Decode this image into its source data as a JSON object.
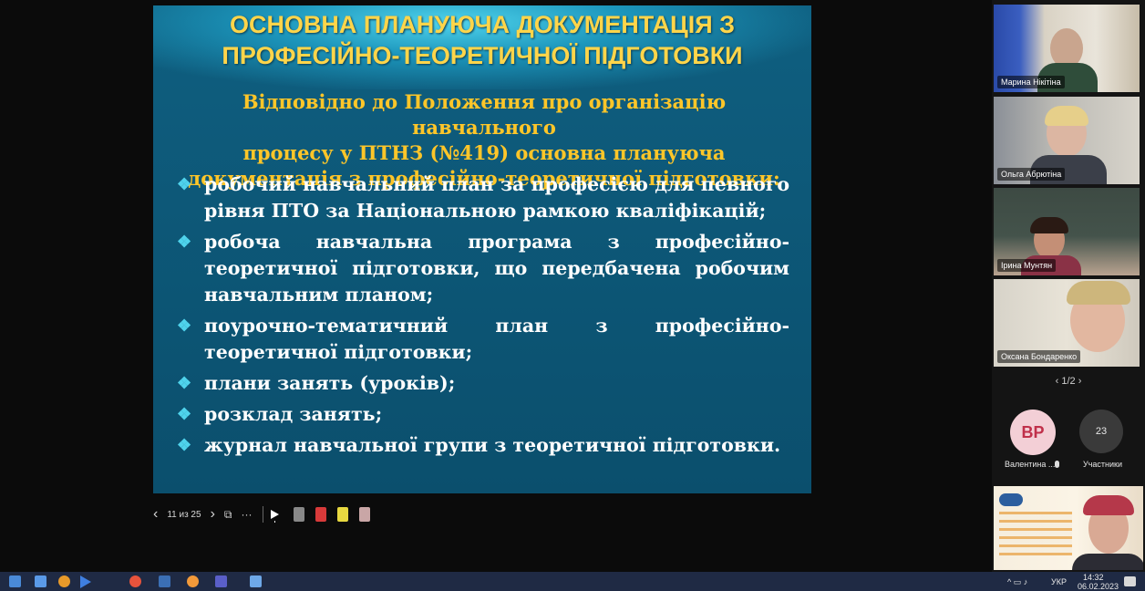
{
  "slide": {
    "title_line1": "ОСНОВНА ПЛАНУЮЧА ДОКУМЕНТАЦІЯ З",
    "title_line2": "ПРОФЕСІЙНО-ТЕОРЕТИЧНОЇ ПІДГОТОВКИ",
    "subtitle_line1": "Відповідно до Положення про організацію навчального",
    "subtitle_line2": "процесу у ПТНЗ (№419) основна плануюча",
    "subtitle_line3": "документація з професійно-теоретичної підготовки:",
    "bullets": [
      "робочий навчальний план за професією для певного рівня ПТО за Національною рамкою кваліфікацій;",
      "робоча навчальна програма з професійно-теоретичної підготовки, що передбачена робочим навчальним планом;",
      "поурочно-тематичний план з професійно-теоретичної підготовки;",
      "плани занять (уроків);",
      "розклад занять;",
      "журнал навчальної групи з теоретичної підготовки."
    ],
    "bullet_mark": "❖"
  },
  "controls": {
    "prev": "‹",
    "page_label": "11 из 25",
    "next": "›",
    "layout_icon": "⧉",
    "more": "···"
  },
  "participants": [
    {
      "name": "Марина Нікітіна"
    },
    {
      "name": "Ольга Абрютіна"
    },
    {
      "name": "Ірина Мунтян"
    },
    {
      "name": "Оксана Бондаренко"
    }
  ],
  "pager": "‹  1/2  ›",
  "avatar_initials": "ВР",
  "avatar_name": "Валентина ...",
  "participants_count": "23",
  "participants_label": "Участники",
  "taskbar": {
    "lang": "УКР",
    "time": "14:32",
    "date": "06.02.2023"
  },
  "colors": {
    "slide_bg": "#0d5878",
    "title": "#ffd54a",
    "subtitle": "#ffc629",
    "bullet_mark": "#4fd3ec",
    "taskbar": "#1f2a44"
  }
}
